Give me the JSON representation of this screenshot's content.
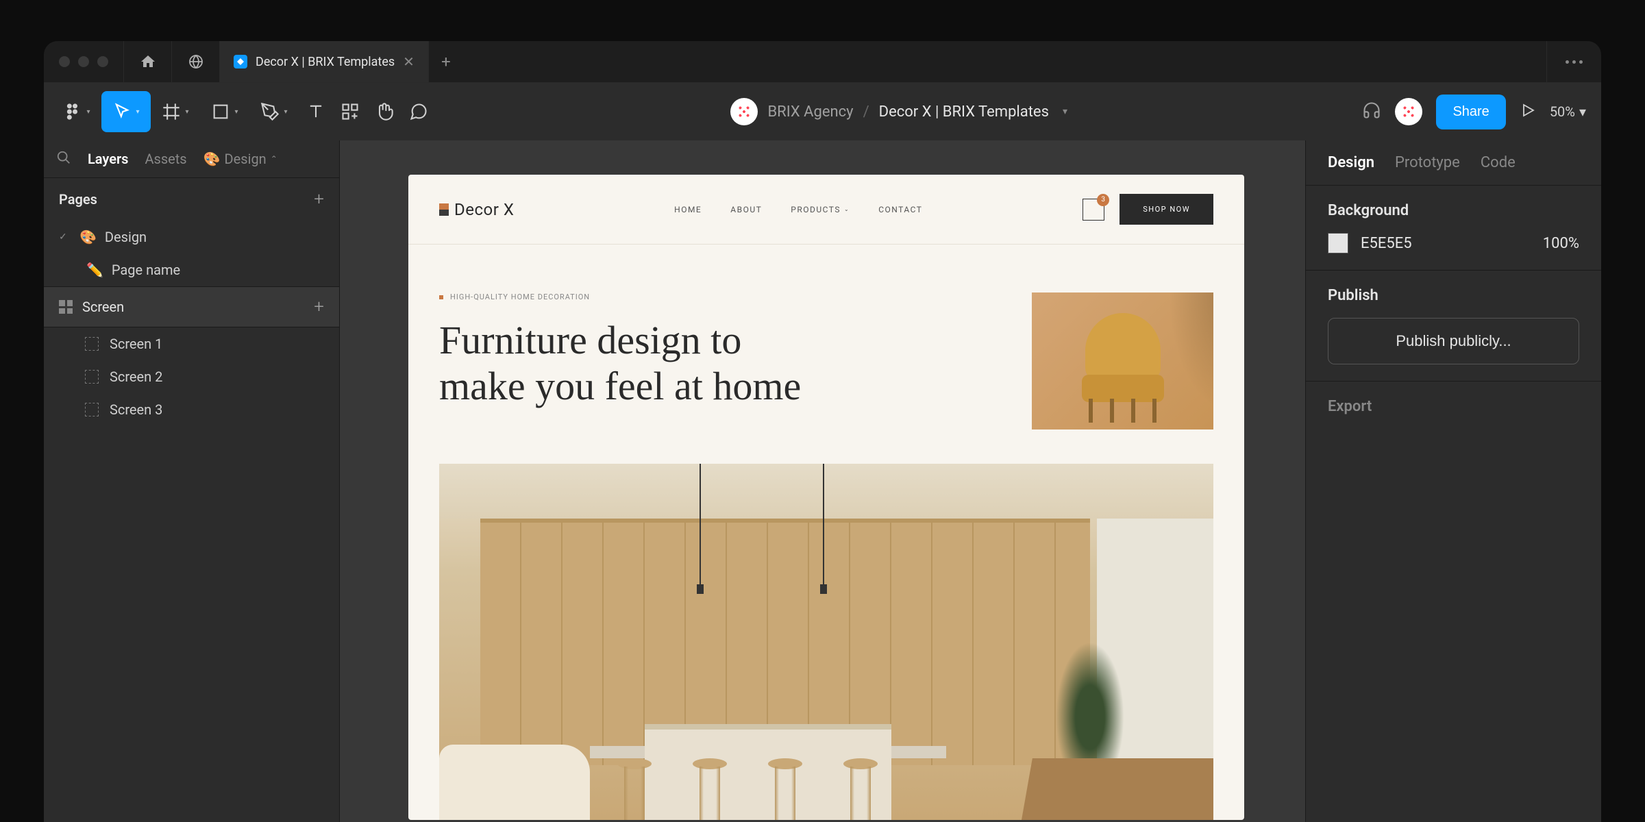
{
  "tabBar": {
    "fileTitle": "Decor X | BRIX Templates"
  },
  "toolbar": {
    "teamName": "BRIX Agency",
    "fileName": "Decor X | BRIX Templates",
    "shareLabel": "Share",
    "zoomLevel": "50%"
  },
  "leftPanel": {
    "tabs": {
      "layers": "Layers",
      "assets": "Assets",
      "design": "Design"
    },
    "pagesLabel": "Pages",
    "pages": [
      {
        "emoji": "🎨",
        "name": "Design"
      },
      {
        "emoji": "✏️",
        "name": "Page name"
      }
    ],
    "screenLabel": "Screen",
    "layers": [
      {
        "name": "Screen 1"
      },
      {
        "name": "Screen 2"
      },
      {
        "name": "Screen 3"
      }
    ]
  },
  "canvas": {
    "logo": "Decor X",
    "nav": {
      "home": "HOME",
      "about": "ABOUT",
      "products": "PRODUCTS",
      "contact": "CONTACT"
    },
    "cartCount": "3",
    "shopNow": "SHOP NOW",
    "eyebrow": "HIGH-QUALITY HOME DECORATION",
    "heroLine1": "Furniture design to",
    "heroLine2": "make you feel at home"
  },
  "rightPanel": {
    "tabs": {
      "design": "Design",
      "prototype": "Prototype",
      "code": "Code"
    },
    "backgroundLabel": "Background",
    "bgColor": "E5E5E5",
    "bgOpacity": "100%",
    "publishLabel": "Publish",
    "publishBtn": "Publish publicly...",
    "exportLabel": "Export"
  }
}
